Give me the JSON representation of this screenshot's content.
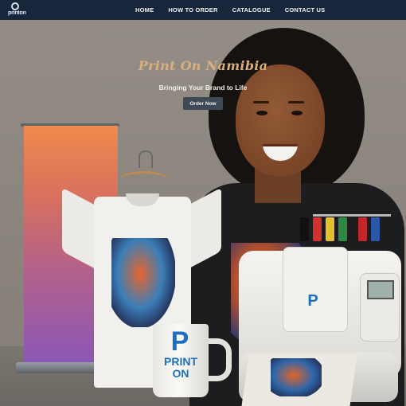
{
  "brand": {
    "logo_text": "printon"
  },
  "nav": {
    "items": [
      {
        "label": "HOME"
      },
      {
        "label": "HOW TO ORDER"
      },
      {
        "label": "CATALOGUE"
      },
      {
        "label": "CONTACT US"
      }
    ]
  },
  "hero": {
    "title": "Print On Namibia",
    "subtitle": "Bringing Your Brand to Life",
    "cta_label": "Order Now"
  },
  "mug": {
    "brand_letter": "P",
    "brand_line1": "PRINT",
    "brand_line2": "ON"
  },
  "machine": {
    "badge_letter": "P"
  },
  "colors": {
    "navbar_bg": "#17263a",
    "title_gold": "#d8b080",
    "button_bg": "#3e4956",
    "brand_blue": "#1c6fc1"
  }
}
